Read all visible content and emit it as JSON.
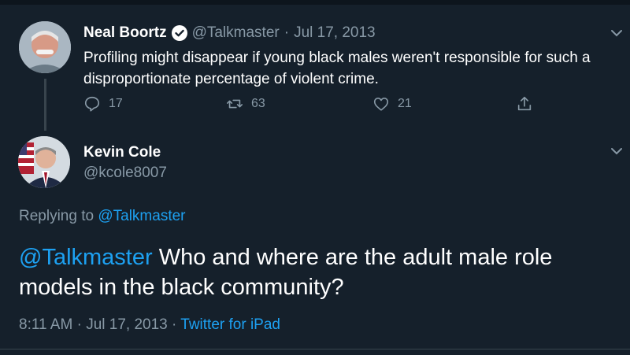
{
  "parent_tweet": {
    "name": "Neal Boortz",
    "handle": "@Talkmaster",
    "separator": "·",
    "date": "Jul 17, 2013",
    "text": "Profiling might disappear if young black males weren't responsible for such a disproportionate percentage of violent crime.",
    "counts": {
      "replies": "17",
      "retweets": "63",
      "likes": "21"
    }
  },
  "reply_tweet": {
    "name": "Kevin Cole",
    "handle": "@kcole8007",
    "replying_prefix": "Replying to",
    "replying_to": "@Talkmaster",
    "mention": "@Talkmaster",
    "text": "Who and where are the adult male role models in the black community?",
    "time": "8:11 AM",
    "separator": "·",
    "date": "Jul 17, 2013",
    "source": "Twitter for iPad"
  },
  "icons": [
    "verified-icon",
    "chevron-down-icon",
    "reply-icon",
    "retweet-icon",
    "like-icon",
    "share-icon"
  ],
  "colors": {
    "background": "#15202b",
    "accent": "#1da1f2",
    "muted": "#8899a6",
    "text": "#ffffff"
  }
}
